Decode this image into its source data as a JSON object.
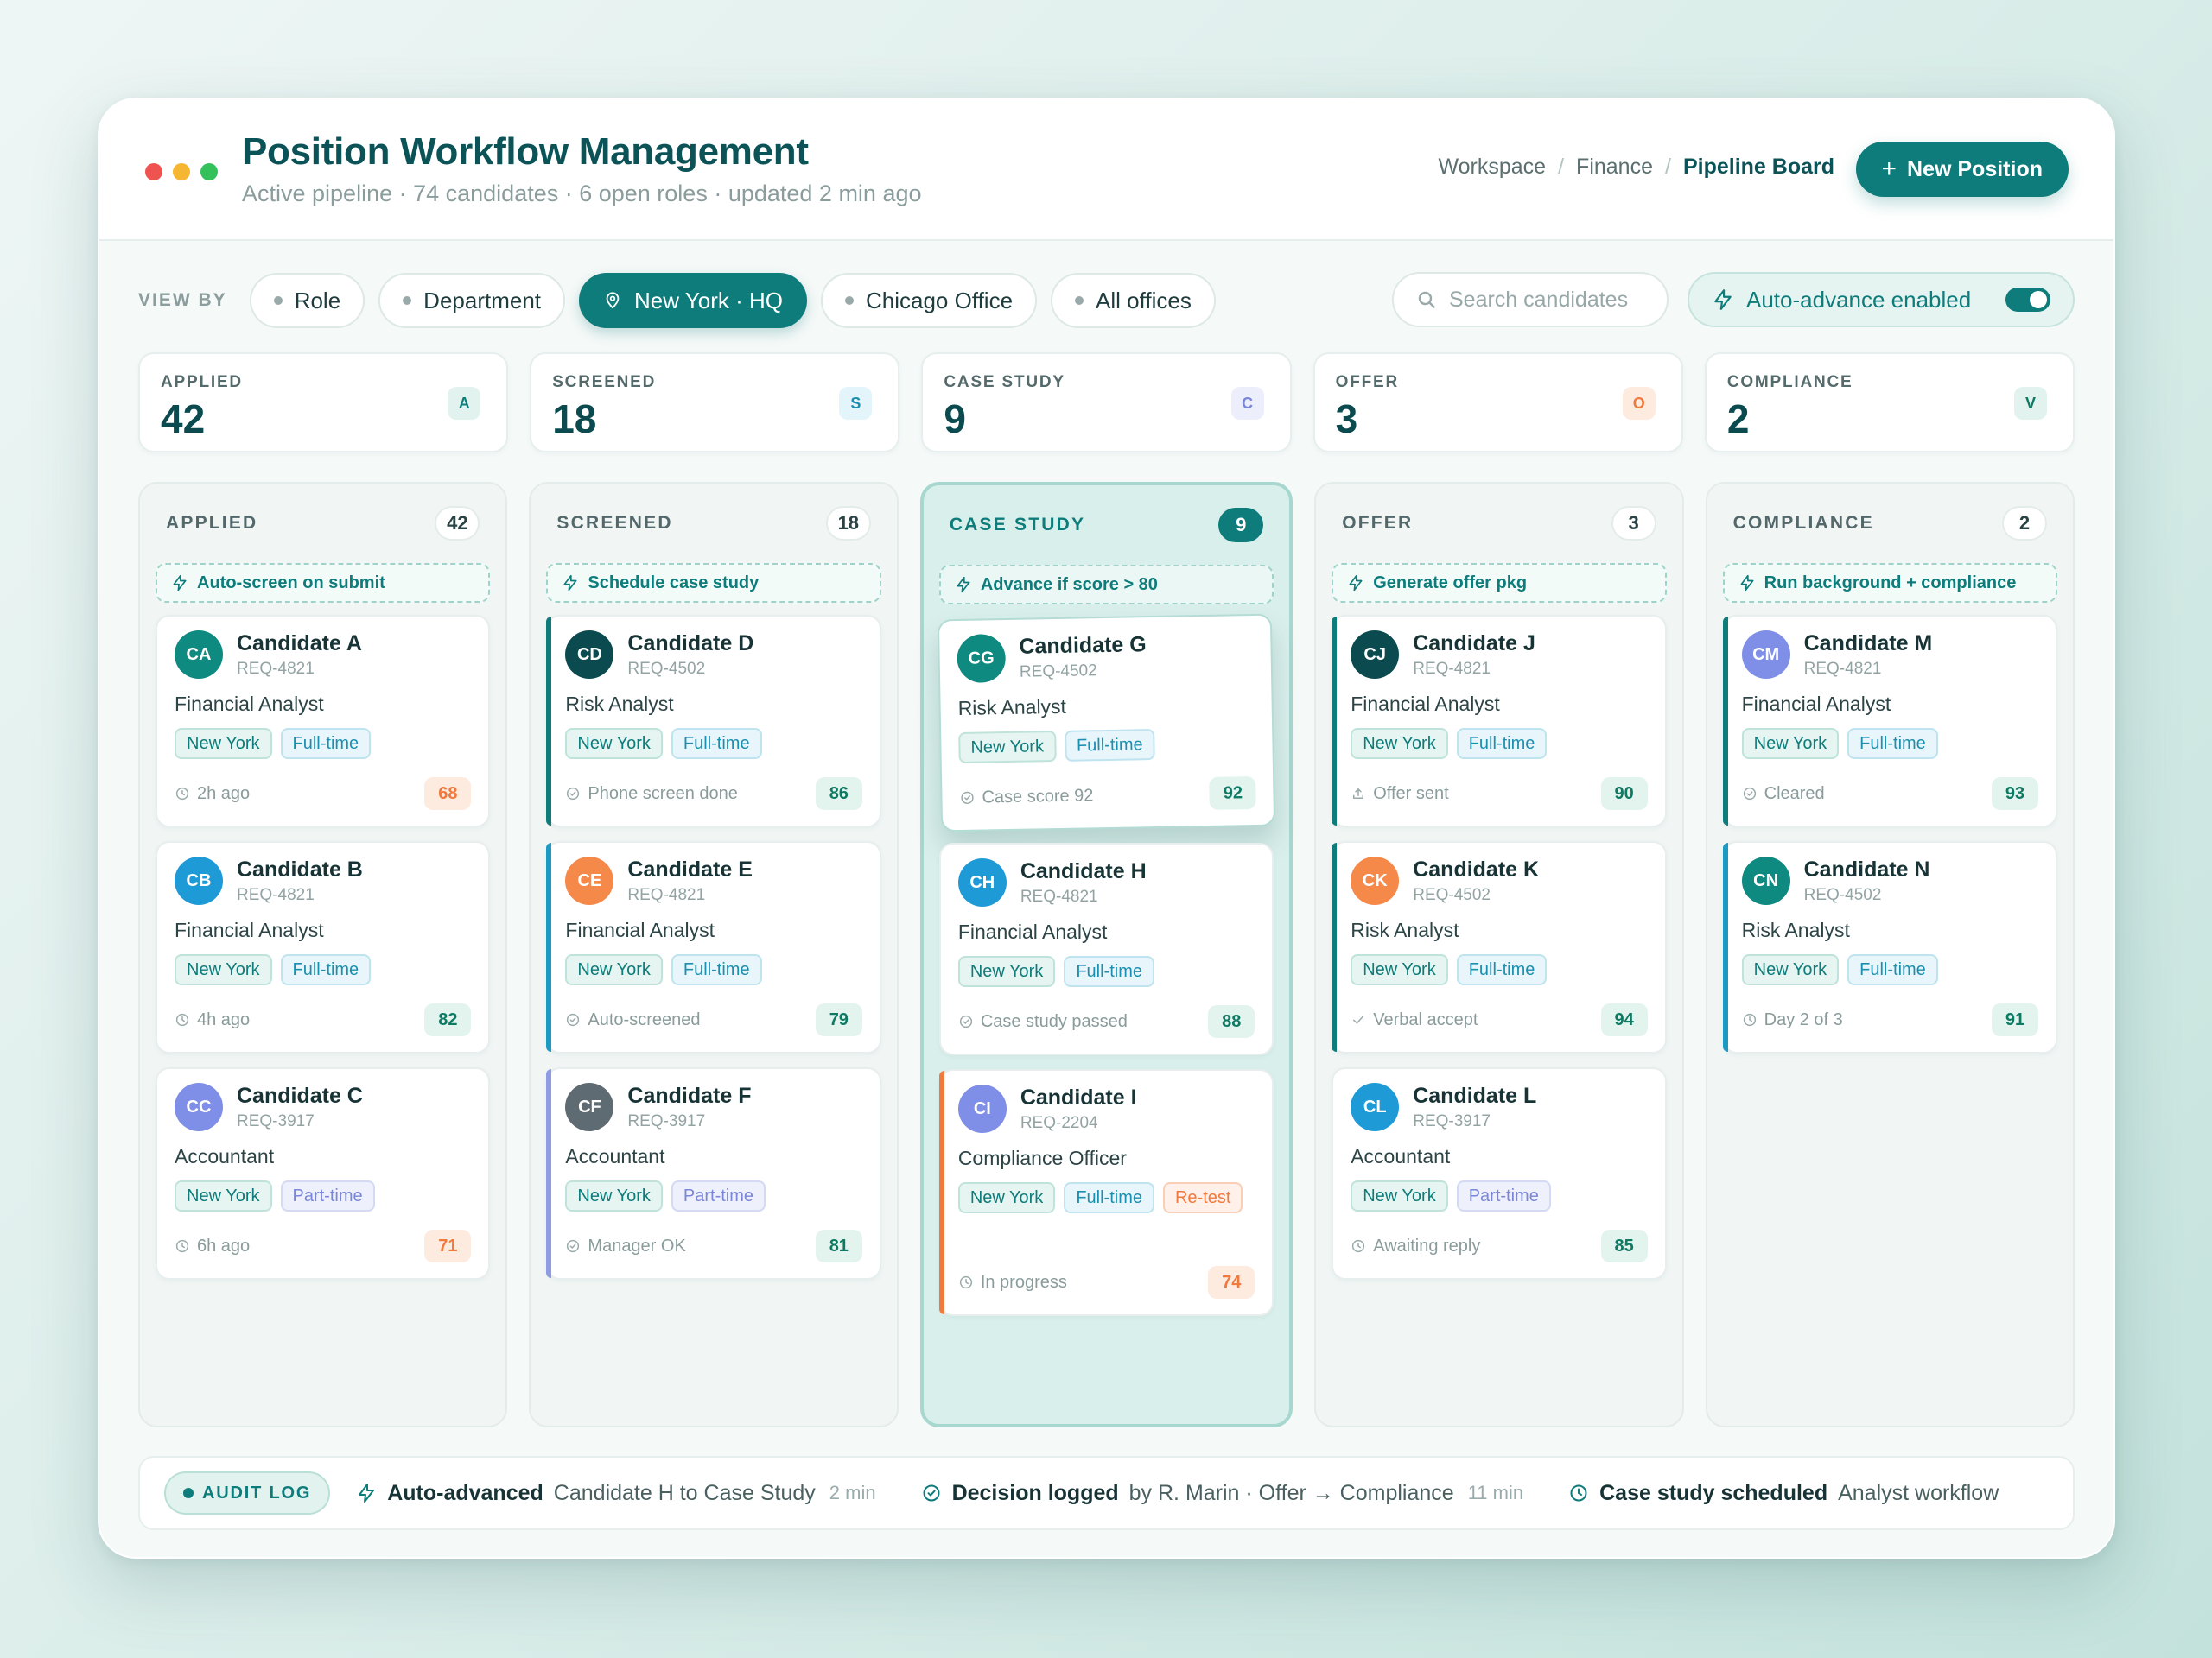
{
  "header": {
    "title": "Position Workflow Management",
    "subtitle": "Active pipeline · 74 candidates · 6 open roles · updated 2 min ago",
    "breadcrumbs": [
      "Workspace",
      "Finance",
      "Pipeline Board"
    ],
    "new_button": "New Position",
    "window_dot_colors": [
      "#ef5350",
      "#f5b731",
      "#34c05a"
    ]
  },
  "filters": {
    "view_by_label": "VIEW BY",
    "chips": [
      {
        "label": "Role",
        "active": false
      },
      {
        "label": "Department",
        "active": false
      },
      {
        "label": "New York · HQ",
        "active": true
      },
      {
        "label": "Chicago Office",
        "active": false
      },
      {
        "label": "All offices",
        "active": false
      }
    ],
    "search_placeholder": "Search candidates",
    "auto_advance_label": "Auto-advance enabled",
    "auto_advance_on": true
  },
  "stats": [
    {
      "label": "APPLIED",
      "value": "42",
      "badge": "A",
      "badge_bg": "#e2f3ef",
      "badge_fg": "#0e7c7b"
    },
    {
      "label": "SCREENED",
      "value": "18",
      "badge": "S",
      "badge_bg": "#e3f4fa",
      "badge_fg": "#1b8fb0"
    },
    {
      "label": "CASE STUDY",
      "value": "9",
      "badge": "C",
      "badge_bg": "#eceefb",
      "badge_fg": "#7a86d8"
    },
    {
      "label": "OFFER",
      "value": "3",
      "badge": "O",
      "badge_bg": "#fdebe0",
      "badge_fg": "#f07a3e"
    },
    {
      "label": "COMPLIANCE",
      "value": "2",
      "badge": "V",
      "badge_bg": "#e2f3ef",
      "badge_fg": "#0f7a63"
    }
  ],
  "columns": [
    {
      "title": "APPLIED",
      "count": "42",
      "active": false,
      "rule": "Auto-screen on submit",
      "cards": [
        {
          "initials": "CA",
          "avatar": "#0e8a80",
          "name": "Candidate A",
          "req": "REQ-4821",
          "role": "Financial Analyst",
          "tags": [
            {
              "t": "New York",
              "k": "loc"
            },
            {
              "t": "Full-time",
              "k": "full"
            }
          ],
          "status": "2h ago",
          "status_icon": "clock",
          "score": "68",
          "score_kind": "warn",
          "accent": ""
        },
        {
          "initials": "CB",
          "avatar": "#1e9bd7",
          "name": "Candidate B",
          "req": "REQ-4821",
          "role": "Financial Analyst",
          "tags": [
            {
              "t": "New York",
              "k": "loc"
            },
            {
              "t": "Full-time",
              "k": "full"
            }
          ],
          "status": "4h ago",
          "status_icon": "clock",
          "score": "82",
          "score_kind": "good",
          "accent": ""
        },
        {
          "initials": "CC",
          "avatar": "#7f8ee6",
          "name": "Candidate C",
          "req": "REQ-3917",
          "role": "Accountant",
          "tags": [
            {
              "t": "New York",
              "k": "loc"
            },
            {
              "t": "Part-time",
              "k": "part"
            }
          ],
          "status": "6h ago",
          "status_icon": "clock",
          "score": "71",
          "score_kind": "warn",
          "accent": ""
        }
      ]
    },
    {
      "title": "SCREENED",
      "count": "18",
      "active": false,
      "rule": "Schedule case study",
      "cards": [
        {
          "initials": "CD",
          "avatar": "#0b4b50",
          "name": "Candidate D",
          "req": "REQ-4502",
          "role": "Risk Analyst",
          "tags": [
            {
              "t": "New York",
              "k": "loc"
            },
            {
              "t": "Full-time",
              "k": "full"
            }
          ],
          "status": "Phone screen done",
          "status_icon": "check-circle",
          "score": "86",
          "score_kind": "good",
          "accent": "#0e7c7b"
        },
        {
          "initials": "CE",
          "avatar": "#f5894a",
          "name": "Candidate E",
          "req": "REQ-4821",
          "role": "Financial Analyst",
          "tags": [
            {
              "t": "New York",
              "k": "loc"
            },
            {
              "t": "Full-time",
              "k": "full"
            }
          ],
          "status": "Auto-screened",
          "status_icon": "check-circle",
          "score": "79",
          "score_kind": "good",
          "accent": "#1b9bc4"
        },
        {
          "initials": "CF",
          "avatar": "#5f6b72",
          "name": "Candidate F",
          "req": "REQ-3917",
          "role": "Accountant",
          "tags": [
            {
              "t": "New York",
              "k": "loc"
            },
            {
              "t": "Part-time",
              "k": "part"
            }
          ],
          "status": "Manager OK",
          "status_icon": "check-circle",
          "score": "81",
          "score_kind": "good",
          "accent": "#8f9be3"
        }
      ]
    },
    {
      "title": "CASE STUDY",
      "count": "9",
      "active": true,
      "rule": "Advance if score > 80",
      "cards": [
        {
          "initials": "CG",
          "avatar": "#0e8a80",
          "name": "Candidate G",
          "req": "REQ-4502",
          "role": "Risk Analyst",
          "tags": [
            {
              "t": "New York",
              "k": "loc"
            },
            {
              "t": "Full-time",
              "k": "full"
            }
          ],
          "status": "Case score 92",
          "status_icon": "check-circle",
          "score": "92",
          "score_kind": "good",
          "accent": "",
          "lift": true
        },
        {
          "initials": "CH",
          "avatar": "#1e9bd7",
          "name": "Candidate H",
          "req": "REQ-4821",
          "role": "Financial Analyst",
          "tags": [
            {
              "t": "New York",
              "k": "loc"
            },
            {
              "t": "Full-time",
              "k": "full"
            }
          ],
          "status": "Case study passed",
          "status_icon": "check-circle",
          "score": "88",
          "score_kind": "good",
          "accent": ""
        },
        {
          "initials": "CI",
          "avatar": "#7f8ee6",
          "name": "Candidate I",
          "req": "REQ-2204",
          "role": "Compliance Officer",
          "tags": [
            {
              "t": "New York",
              "k": "loc"
            },
            {
              "t": "Full-time",
              "k": "full"
            },
            {
              "t": "Re-test",
              "k": "retest"
            }
          ],
          "status": "In progress",
          "status_icon": "clock",
          "score": "74",
          "score_kind": "warn",
          "accent": "#f07a3e",
          "tall": true
        }
      ]
    },
    {
      "title": "OFFER",
      "count": "3",
      "active": false,
      "rule": "Generate offer pkg",
      "cards": [
        {
          "initials": "CJ",
          "avatar": "#0b4b50",
          "name": "Candidate J",
          "req": "REQ-4821",
          "role": "Financial Analyst",
          "tags": [
            {
              "t": "New York",
              "k": "loc"
            },
            {
              "t": "Full-time",
              "k": "full"
            }
          ],
          "status": "Offer sent",
          "status_icon": "upload",
          "score": "90",
          "score_kind": "good",
          "accent": "#0e7c7b"
        },
        {
          "initials": "CK",
          "avatar": "#f5894a",
          "name": "Candidate K",
          "req": "REQ-4502",
          "role": "Risk Analyst",
          "tags": [
            {
              "t": "New York",
              "k": "loc"
            },
            {
              "t": "Full-time",
              "k": "full"
            }
          ],
          "status": "Verbal accept",
          "status_icon": "check",
          "score": "94",
          "score_kind": "good",
          "accent": "#0e7c7b"
        },
        {
          "initials": "CL",
          "avatar": "#1e9bd7",
          "name": "Candidate L",
          "req": "REQ-3917",
          "role": "Accountant",
          "tags": [
            {
              "t": "New York",
              "k": "loc"
            },
            {
              "t": "Part-time",
              "k": "part"
            }
          ],
          "status": "Awaiting reply",
          "status_icon": "clock",
          "score": "85",
          "score_kind": "good",
          "accent": ""
        }
      ]
    },
    {
      "title": "COMPLIANCE",
      "count": "2",
      "active": false,
      "rule": "Run background + compliance",
      "cards": [
        {
          "initials": "CM",
          "avatar": "#7f8ee6",
          "name": "Candidate M",
          "req": "REQ-4821",
          "role": "Financial Analyst",
          "tags": [
            {
              "t": "New York",
              "k": "loc"
            },
            {
              "t": "Full-time",
              "k": "full"
            }
          ],
          "status": "Cleared",
          "status_icon": "check-circle",
          "score": "93",
          "score_kind": "good",
          "accent": "#0e7c7b"
        },
        {
          "initials": "CN",
          "avatar": "#0e8a80",
          "name": "Candidate N",
          "req": "REQ-4502",
          "role": "Risk Analyst",
          "tags": [
            {
              "t": "New York",
              "k": "loc"
            },
            {
              "t": "Full-time",
              "k": "full"
            }
          ],
          "status": "Day 2 of 3",
          "status_icon": "clock",
          "score": "91",
          "score_kind": "good",
          "accent": "#1b9bc4"
        }
      ]
    }
  ],
  "audit": {
    "badge": "AUDIT LOG",
    "events": [
      {
        "icon": "bolt",
        "title": "Auto-advanced",
        "desc": "Candidate H to Case Study",
        "time": "2 min"
      },
      {
        "icon": "check-circle",
        "title": "Decision logged",
        "desc": "by R. Marin · Offer → Compliance",
        "time": "11 min"
      },
      {
        "icon": "clock",
        "title": "Case study scheduled",
        "desc": "Analyst workflow",
        "time": ""
      }
    ]
  }
}
